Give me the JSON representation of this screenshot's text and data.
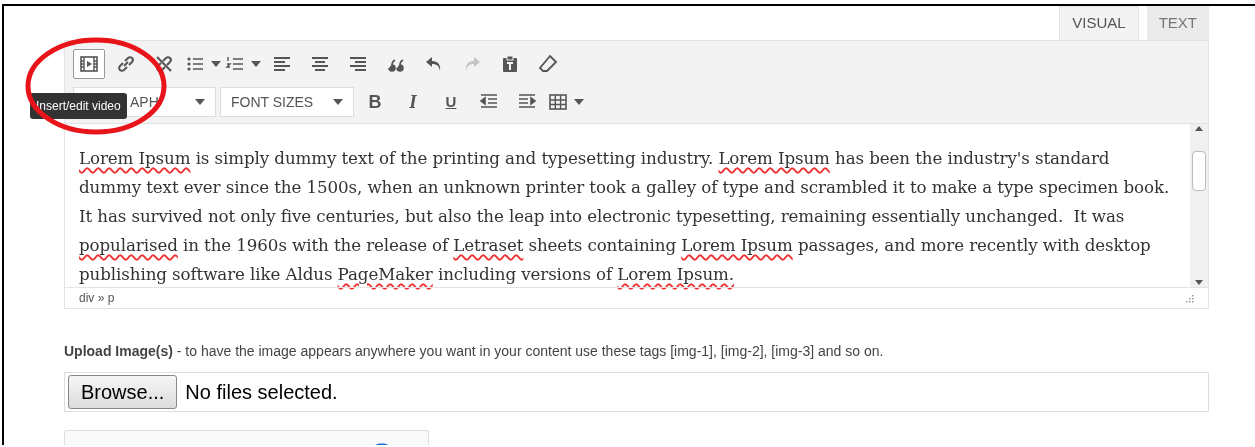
{
  "tabs": [
    {
      "label": "VISUAL",
      "selected": true
    },
    {
      "label": "TEXT",
      "selected": false
    }
  ],
  "toolbar_rows": [
    [
      {
        "kind": "video",
        "selected": true,
        "disabled": false
      },
      {
        "kind": "link",
        "selected": false,
        "disabled": false
      },
      {
        "kind": "unlink",
        "selected": false,
        "disabled": false
      },
      {
        "kind": "bullets",
        "selected": false,
        "disabled": false
      },
      {
        "kind": "numbers",
        "selected": false,
        "disabled": false
      },
      {
        "kind": "align-left",
        "selected": false,
        "disabled": false
      },
      {
        "kind": "align-center",
        "selected": false,
        "disabled": false
      },
      {
        "kind": "align-right",
        "selected": false,
        "disabled": false
      },
      {
        "kind": "quote",
        "selected": false,
        "disabled": false
      },
      {
        "kind": "undo",
        "selected": false,
        "disabled": false
      },
      {
        "kind": "redo",
        "selected": false,
        "disabled": true
      },
      {
        "kind": "paste",
        "selected": false,
        "disabled": false
      },
      {
        "kind": "eraser",
        "selected": false,
        "disabled": false
      }
    ],
    [
      {
        "kind": "select",
        "label": "APH"
      },
      {
        "kind": "select",
        "label": "FONT SIZES"
      },
      {
        "kind": "bold",
        "label": "B"
      },
      {
        "kind": "italic",
        "label": "I"
      },
      {
        "kind": "underline",
        "label": "U"
      },
      {
        "kind": "outdent"
      },
      {
        "kind": "indent"
      },
      {
        "kind": "table"
      }
    ]
  ],
  "tooltip": "Insert/edit video",
  "content": [
    {
      "text": "Lorem Ipsum",
      "misspelled": true
    },
    {
      "text": " is simply dummy text of the printing and typesetting industry. ",
      "misspelled": false
    },
    {
      "text": "Lorem Ipsum",
      "misspelled": true
    },
    {
      "text": " has been the industry's standard dummy text ever since the 1500s, when an unknown printer took a galley of type and scrambled it to make a type specimen book. It has survived not only five centuries, but also the leap into electronic typesetting, remaining essentially unchanged.  It was ",
      "misspelled": false
    },
    {
      "text": "popularised",
      "misspelled": true
    },
    {
      "text": " in the 1960s with the release of ",
      "misspelled": false
    },
    {
      "text": "Letraset",
      "misspelled": true
    },
    {
      "text": " sheets containing ",
      "misspelled": false
    },
    {
      "text": "Lorem Ipsum",
      "misspelled": true
    },
    {
      "text": " passages, and more recently with desktop publishing software like Aldus ",
      "misspelled": false
    },
    {
      "text": "PageMaker",
      "misspelled": true
    },
    {
      "text": " including versions of ",
      "misspelled": false
    },
    {
      "text": "Lorem Ipsum.",
      "misspelled": true
    }
  ],
  "status_path": "div » p",
  "upload_note": "**Upload Image(s)** - to have the image appears anywhere you want in your content use these tags [img-1], [img-2], [img-3] and so on.",
  "file_input": {
    "button": "Browse...",
    "value": "No files selected."
  }
}
